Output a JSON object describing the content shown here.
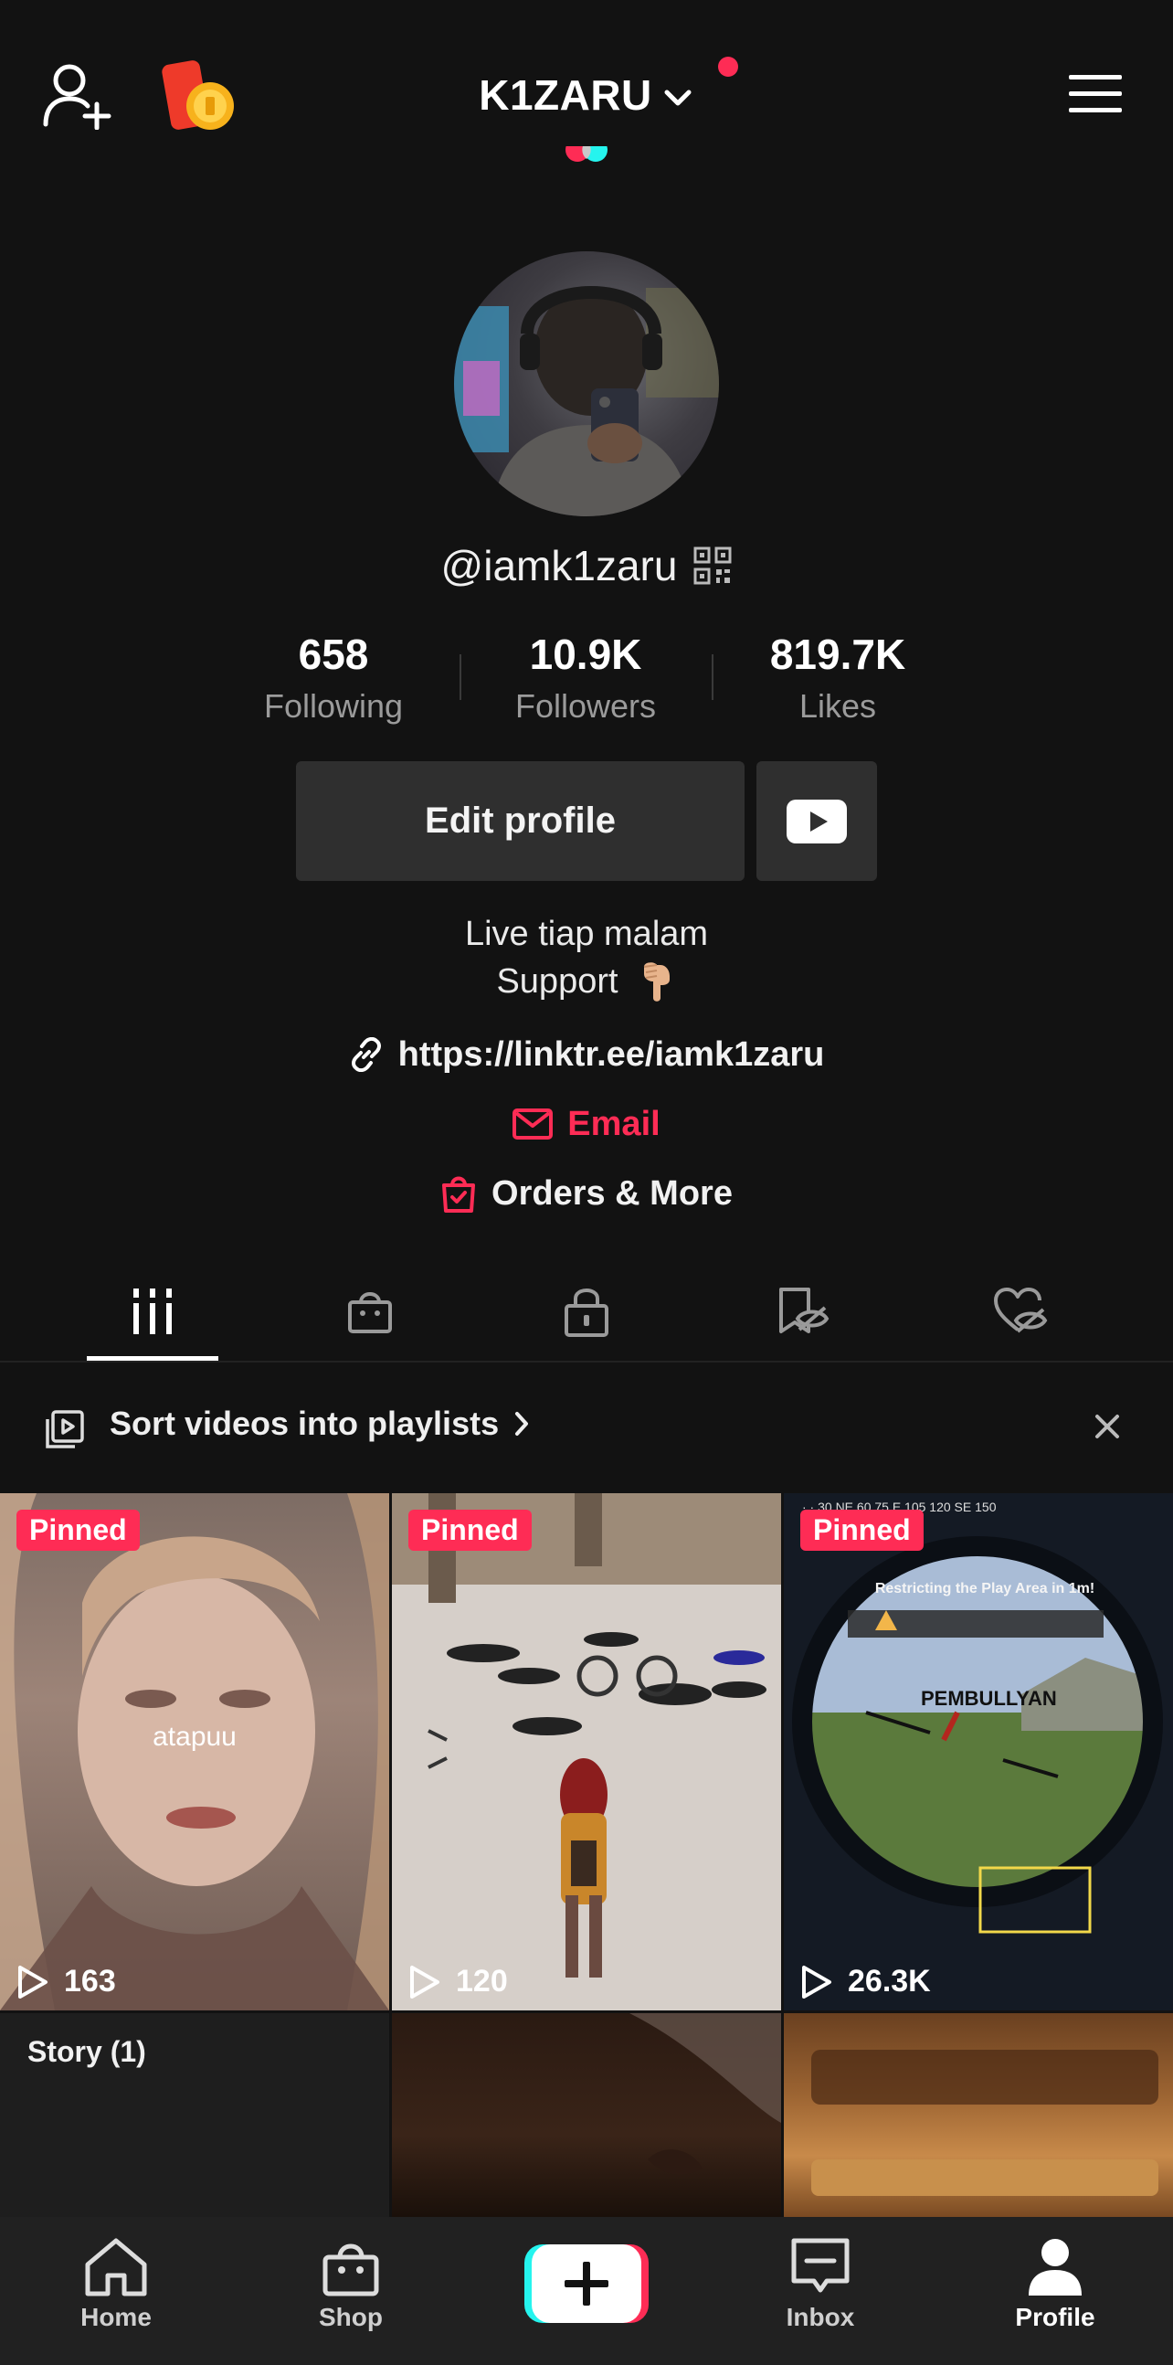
{
  "header": {
    "title": "K1ZARU",
    "notification_dot_color": "#fe2c55"
  },
  "profile": {
    "username": "@iamk1zaru",
    "stats": [
      {
        "value": "658",
        "label": "Following"
      },
      {
        "value": "10.9K",
        "label": "Followers"
      },
      {
        "value": "819.7K",
        "label": "Likes"
      }
    ],
    "edit_label": "Edit profile",
    "bio_line1": "Live tiap malam",
    "bio_line2": "Support",
    "link": "https://linktr.ee/iamk1zaru",
    "email_label": "Email",
    "orders_label": "Orders & More"
  },
  "tabs": [
    {
      "icon": "grid-icon",
      "active": true
    },
    {
      "icon": "shop-bag-icon",
      "active": false
    },
    {
      "icon": "lock-icon",
      "active": false
    },
    {
      "icon": "hidden-bookmark-icon",
      "active": false
    },
    {
      "icon": "hidden-heart-icon",
      "active": false
    }
  ],
  "playlist_banner": {
    "text": "Sort videos into playlists"
  },
  "videos": [
    {
      "badge": "Pinned",
      "views": "163",
      "caption": "atapuu"
    },
    {
      "badge": "Pinned",
      "views": "120"
    },
    {
      "badge": "Pinned",
      "views": "26.3K",
      "game_text": "PEMBULLYAN",
      "game_alert": "Restricting the Play Area in 1m!"
    },
    {
      "label": "Story (1)"
    },
    {},
    {}
  ],
  "bottom_nav": [
    {
      "label": "Home",
      "icon": "home-icon"
    },
    {
      "label": "Shop",
      "icon": "shop-icon"
    },
    {
      "label": "",
      "icon": "create-plus-icon"
    },
    {
      "label": "Inbox",
      "icon": "inbox-icon"
    },
    {
      "label": "Profile",
      "icon": "profile-icon",
      "active": true
    }
  ],
  "colors": {
    "background": "#121212",
    "accent": "#fe2c55",
    "button": "#2f2f2f",
    "cyan": "#25f4ee"
  }
}
